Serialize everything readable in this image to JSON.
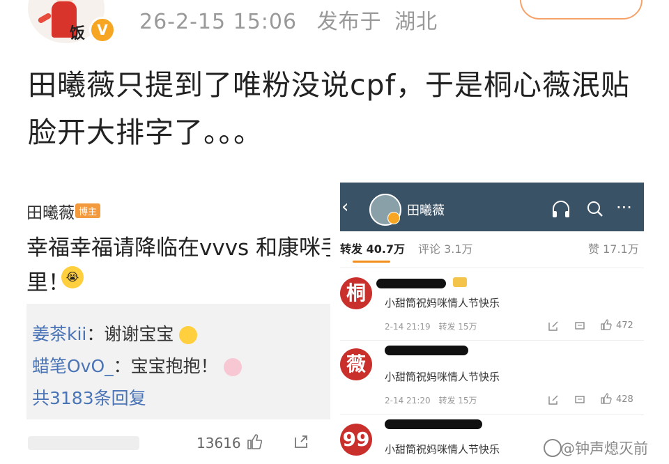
{
  "post": {
    "avatar_text": "饭",
    "vip_badge": "V",
    "timestamp": "26-2-15 15:06",
    "location_prefix": "发布于",
    "location": "湖北",
    "text": "田曦薇只提到了唯粉没说cpf，于是桐心薇泯贴脸开大排字了。。。"
  },
  "left_card": {
    "author": "田曦薇",
    "author_tag": "博主",
    "line1": "幸福幸福请降临在vvvs 和康咪手",
    "line2": "里！",
    "replies": [
      {
        "nick": "姜茶kii",
        "text": "：谢谢宝宝"
      },
      {
        "nick": "蜡笔OvO_",
        "text": "：宝宝抱抱！"
      }
    ],
    "reply_total": "共3183条回复",
    "like_count": "13616"
  },
  "right_panel": {
    "title": "田曦薇",
    "tabs": [
      {
        "label": "转发 40.7万",
        "active": true
      },
      {
        "label": "评论 3.1万",
        "active": false
      },
      {
        "label": "赞 17.1万",
        "active": false
      }
    ],
    "comments": [
      {
        "avatar": "桐",
        "text": "小甜筒祝妈咪情人节快乐",
        "time": "2-14 21:19",
        "repost": "转发 15万",
        "likes": "472"
      },
      {
        "avatar": "薇",
        "text": "小甜筒祝妈咪情人节快乐",
        "time": "2-14 21:20",
        "repost": "转发 15万",
        "likes": "428"
      },
      {
        "avatar": "99",
        "text": "小甜筒祝妈咪情人节快乐",
        "time": "",
        "repost": "",
        "likes": ""
      }
    ]
  },
  "watermark": "@钟声熄灭前",
  "colors": {
    "accent": "#f28e1c",
    "link": "#4a74b6",
    "header_bg": "#3a5266",
    "avatar_red": "#c9302c"
  }
}
